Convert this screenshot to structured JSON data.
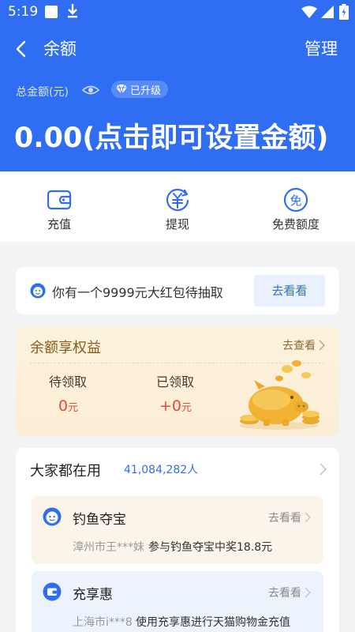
{
  "status_bar": {
    "time": "5:19"
  },
  "header": {
    "title": "余额",
    "manage": "管理",
    "total_label": "总金额(元)",
    "upgrade_badge": "已升级",
    "amount": "0.00(点击即可设置金额)"
  },
  "actions": [
    {
      "label": "充值",
      "icon": "wallet-icon"
    },
    {
      "label": "提现",
      "icon": "yuan-withdraw-icon"
    },
    {
      "label": "免费额度",
      "icon": "free-quota-icon"
    }
  ],
  "red_packet": {
    "text": "你有一个9999元大红包待抽取",
    "button": "去看看"
  },
  "benefit": {
    "title": "余额享权益",
    "link": "去查看",
    "pending_label": "待领取",
    "pending_value": "0",
    "pending_unit": "元",
    "received_label": "已领取",
    "received_prefix": "+",
    "received_value": "0",
    "received_unit": "元"
  },
  "popular": {
    "title": "大家都在用",
    "count": "41,084,282人",
    "items": [
      {
        "title": "钓鱼夺宝",
        "link": "去看看",
        "user": "漳州市王***妹",
        "desc": "参与钓鱼夺宝中奖18.8元"
      },
      {
        "title": "充享惠",
        "link": "去看看",
        "user": "上海市i***8",
        "desc": "使用充享惠进行天猫购物金充值"
      }
    ]
  },
  "colors": {
    "brand_blue": "#2f6ef3",
    "accent_red": "#e8473a",
    "gold": "#f2b233"
  }
}
